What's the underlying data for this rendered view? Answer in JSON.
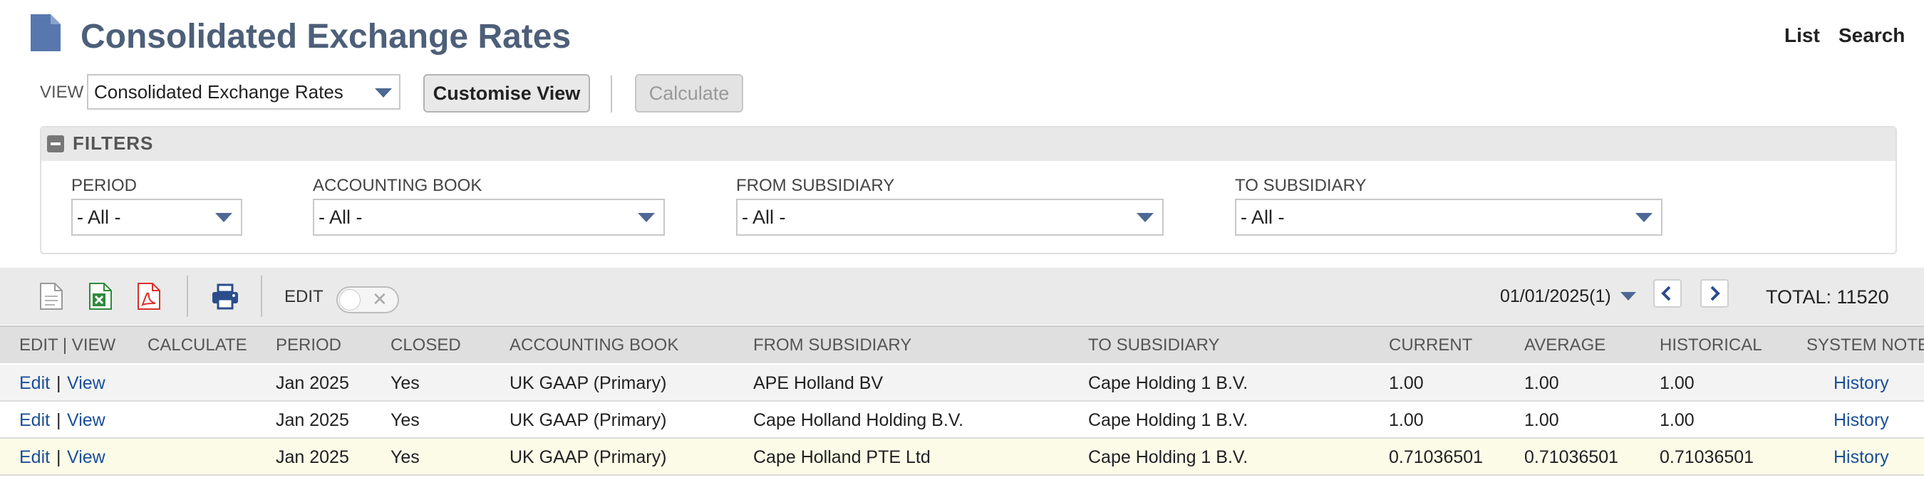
{
  "header": {
    "title": "Consolidated Exchange Rates",
    "links": {
      "list": "List",
      "search": "Search"
    }
  },
  "view": {
    "label": "VIEW",
    "selected": "Consolidated Exchange Rates",
    "customise_button": "Customise View",
    "calculate_button": "Calculate"
  },
  "filters": {
    "title": "FILTERS",
    "period": {
      "label": "PERIOD",
      "value": "- All -"
    },
    "accounting_book": {
      "label": "ACCOUNTING BOOK",
      "value": "- All -"
    },
    "from_subsidiary": {
      "label": "FROM SUBSIDIARY",
      "value": "- All -"
    },
    "to_subsidiary": {
      "label": "TO SUBSIDIARY",
      "value": "- All -"
    }
  },
  "toolbar": {
    "edit_label": "EDIT",
    "date_selector": "01/01/2025(1)",
    "total": "TOTAL: 11520"
  },
  "table": {
    "columns": {
      "edit_view": "EDIT | VIEW",
      "calculate": "CALCULATE",
      "period": "PERIOD",
      "closed": "CLOSED",
      "accounting_book": "ACCOUNTING BOOK",
      "from_subsidiary": "FROM SUBSIDIARY",
      "to_subsidiary": "TO SUBSIDIARY",
      "current": "CURRENT",
      "average": "AVERAGE",
      "historical": "HISTORICAL",
      "system_notes": "SYSTEM NOTES"
    },
    "rows": [
      {
        "edit": "Edit",
        "sep": "|",
        "view": "View",
        "period": "Jan 2025",
        "closed": "Yes",
        "accounting_book": "UK GAAP (Primary)",
        "from_subsidiary": "APE Holland BV",
        "to_subsidiary": "Cape Holding 1 B.V.",
        "current": "1.00",
        "average": "1.00",
        "historical": "1.00",
        "notes": "History"
      },
      {
        "edit": "Edit",
        "sep": "|",
        "view": "View",
        "period": "Jan 2025",
        "closed": "Yes",
        "accounting_book": "UK GAAP (Primary)",
        "from_subsidiary": "Cape Holland Holding B.V.",
        "to_subsidiary": "Cape Holding 1 B.V.",
        "current": "1.00",
        "average": "1.00",
        "historical": "1.00",
        "notes": "History"
      },
      {
        "edit": "Edit",
        "sep": "|",
        "view": "View",
        "period": "Jan 2025",
        "closed": "Yes",
        "accounting_book": "UK GAAP (Primary)",
        "from_subsidiary": "Cape Holland PTE Ltd",
        "to_subsidiary": "Cape Holding 1 B.V.",
        "current": "0.71036501",
        "average": "0.71036501",
        "historical": "0.71036501",
        "notes": "History"
      }
    ]
  },
  "colors": {
    "title": "#4d5f79",
    "link": "#1a4f99",
    "accent": "#4d6894",
    "row_striped": "#f3f3f3",
    "row_highlight": "#fbfbe8"
  }
}
